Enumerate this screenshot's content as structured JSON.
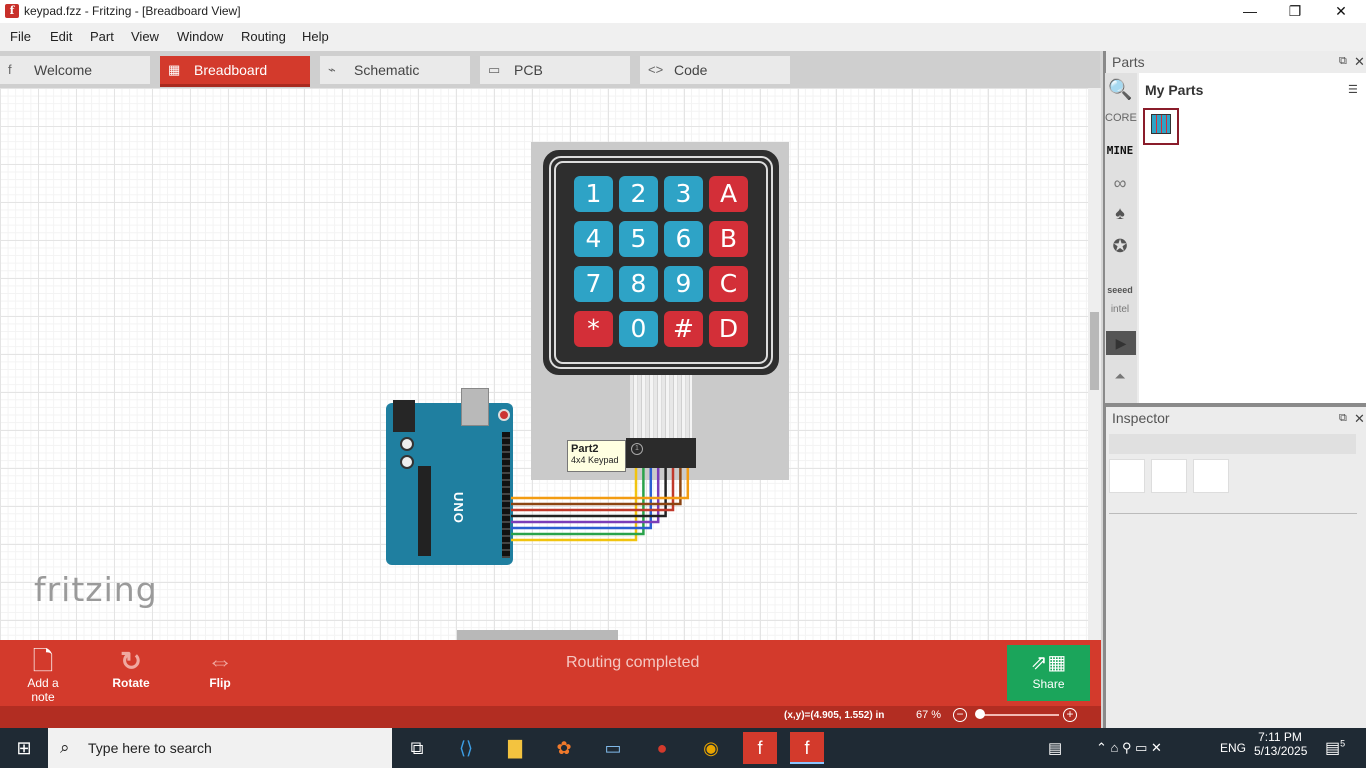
{
  "window": {
    "title": "keypad.fzz - Fritzing - [Breadboard View]",
    "minimize": "—",
    "maximize": "❐",
    "close": "✕"
  },
  "menu": [
    "File",
    "Edit",
    "Part",
    "View",
    "Window",
    "Routing",
    "Help"
  ],
  "tabs": [
    {
      "label": "Welcome",
      "icon": "f"
    },
    {
      "label": "Breadboard",
      "icon": "▦"
    },
    {
      "label": "Schematic",
      "icon": "⌁"
    },
    {
      "label": "PCB",
      "icon": "▭"
    },
    {
      "label": "Code",
      "icon": "<>"
    }
  ],
  "active_tab": "Breadboard",
  "keypad": {
    "keys": [
      "1",
      "2",
      "3",
      "A",
      "4",
      "5",
      "6",
      "B",
      "7",
      "8",
      "9",
      "C",
      "*",
      "0",
      "#",
      "D"
    ],
    "colors": {
      "digit": "#2ea3c6",
      "letter": "#d32f38"
    }
  },
  "tooltip": {
    "name": "Part2",
    "desc": "4x4 Keypad"
  },
  "arduino_label": "UNO",
  "logo": "fritzing",
  "toolbar": {
    "add_note": "Add a note",
    "rotate": "Rotate",
    "flip": "Flip",
    "status": "Routing completed",
    "share": "Share"
  },
  "status": {
    "coords": "(x,y)=(4.905, 1.552) in",
    "zoom": "67 %",
    "zoom_out": "−",
    "zoom_in": "+"
  },
  "parts": {
    "title": "Parts",
    "bins": [
      "CORE",
      "MINE",
      "seeed",
      "intel"
    ],
    "my_parts": "My Parts"
  },
  "inspector": {
    "title": "Inspector"
  },
  "taskbar": {
    "search_placeholder": "Type here to search",
    "time": "7:11 PM",
    "date": "5/13/2025",
    "lang": "ENG",
    "notifications": "5"
  },
  "accent": "#d33a2c",
  "share_color": "#1ba55b",
  "wire_colors": [
    "#f1c40f",
    "#2aa24a",
    "#2b5fd1",
    "#7a3db8",
    "#222222",
    "#c0392b",
    "#8b4513",
    "#f39c12"
  ]
}
